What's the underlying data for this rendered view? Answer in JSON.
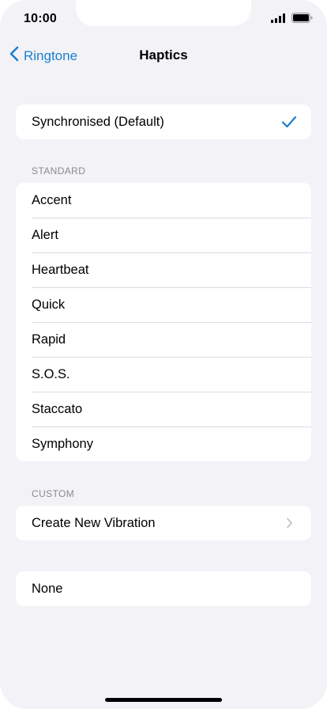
{
  "status_bar": {
    "time": "10:00",
    "icons": [
      "signal-icon",
      "battery-icon"
    ]
  },
  "nav": {
    "back_label": "Ringtone",
    "title": "Haptics"
  },
  "default_group": {
    "label": "Synchronised (Default)",
    "selected": true,
    "check_color": "#1b7fd1"
  },
  "standard": {
    "header": "STANDARD",
    "items": [
      {
        "label": "Accent"
      },
      {
        "label": "Alert"
      },
      {
        "label": "Heartbeat"
      },
      {
        "label": "Quick"
      },
      {
        "label": "Rapid"
      },
      {
        "label": "S.O.S."
      },
      {
        "label": "Staccato"
      },
      {
        "label": "Symphony"
      }
    ]
  },
  "custom": {
    "header": "CUSTOM",
    "create_label": "Create New Vibration"
  },
  "none_group": {
    "label": "None"
  },
  "colors": {
    "accent": "#1b7fd1",
    "background": "#f2f2f7",
    "separator": "#dcdce1",
    "secondary_text": "#8a8a8e"
  }
}
